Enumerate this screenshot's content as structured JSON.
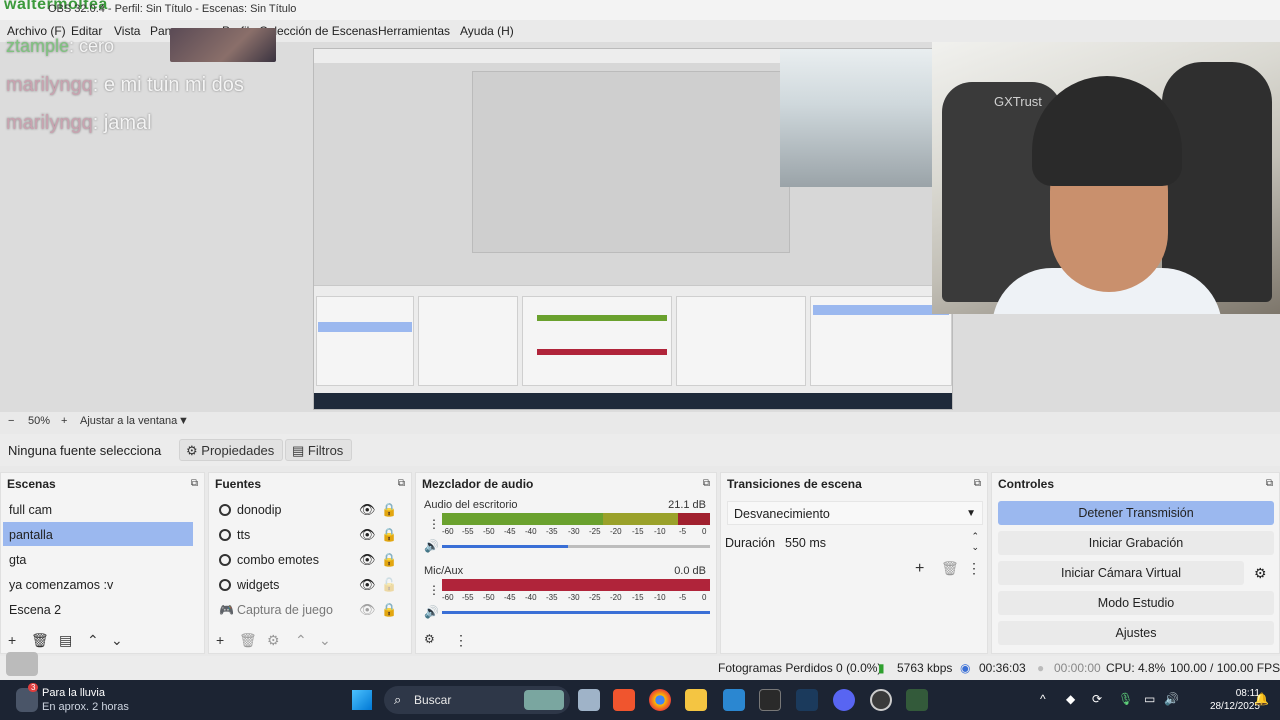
{
  "window": {
    "title": "OBS 32.0.4 - Perfil: Sin Título - Escenas: Sin Título",
    "overlay_name": "waltermoltea"
  },
  "menu": [
    "Archivo (F)",
    "Editar",
    "Vista",
    "Panel (D)",
    "Perfil",
    "Colección de Escenas",
    "Herramientas",
    "Ayuda (H)"
  ],
  "chat": [
    {
      "user": "ztample",
      "text": ": cero"
    },
    {
      "user": "marilyngq",
      "text": ": e mi tuin mi dos"
    },
    {
      "user": "marilyngq",
      "text": ": jamal"
    }
  ],
  "webcam": {
    "brand": "GXTrust"
  },
  "zoom": {
    "minus": "−",
    "value": "50%",
    "plus": "+",
    "fit": "Ajustar a la ventana"
  },
  "source_bar": {
    "label": "Ninguna fuente selecciona",
    "properties": "Propiedades",
    "filters": "Filtros"
  },
  "scenes": {
    "title": "Escenas",
    "items": [
      "full cam",
      "pantalla",
      "gta",
      "ya comenzamos :v",
      "Escena 2"
    ],
    "selected": 1
  },
  "sources": {
    "title": "Fuentes",
    "items": [
      {
        "name": "donodip",
        "visible": true,
        "locked": true
      },
      {
        "name": "tts",
        "visible": true,
        "locked": true
      },
      {
        "name": "combo emotes",
        "visible": true,
        "locked": true
      },
      {
        "name": "widgets",
        "visible": true,
        "locked": false
      },
      {
        "name": "Captura de juego",
        "visible": false,
        "locked": true
      }
    ]
  },
  "mixer": {
    "title": "Mezclador de audio",
    "scale": [
      "-60",
      "-55",
      "-50",
      "-45",
      "-40",
      "-35",
      "-30",
      "-25",
      "-20",
      "-15",
      "-10",
      "-5",
      "0"
    ],
    "channels": [
      {
        "name": "Audio del escritorio",
        "db": "21.1 dB",
        "volume": 0.47
      },
      {
        "name": "Mic/Aux",
        "db": "0.0 dB",
        "volume": 1.0
      }
    ]
  },
  "transitions": {
    "title": "Transiciones de escena",
    "selected": "Desvanecimiento",
    "duration_label": "Duración",
    "duration_value": "550 ms"
  },
  "controls": {
    "title": "Controles",
    "buttons": [
      "Detener Transmisión",
      "Iniciar Grabación",
      "Iniciar Cámara Virtual",
      "Modo Estudio",
      "Ajustes"
    ]
  },
  "status": {
    "dropped": "Fotogramas Perdidos 0 (0.0%)",
    "bitrate": "5763 kbps",
    "stream_time": "00:36:03",
    "rec_time": "00:00:00",
    "cpu": "CPU: 4.8%",
    "fps": "100.00 / 100.00 FPS"
  },
  "taskbar": {
    "weather_title": "Para la lluvia",
    "weather_sub": "En aprox. 2 horas",
    "search": "Buscar",
    "time": "08:11",
    "date": "28/12/2025",
    "notif_badge": "3"
  },
  "colors": {
    "accent": "#9bb8ef",
    "taskbar": "#1c2433",
    "meter_green": "#6aa12e",
    "meter_red": "#b0243a"
  }
}
